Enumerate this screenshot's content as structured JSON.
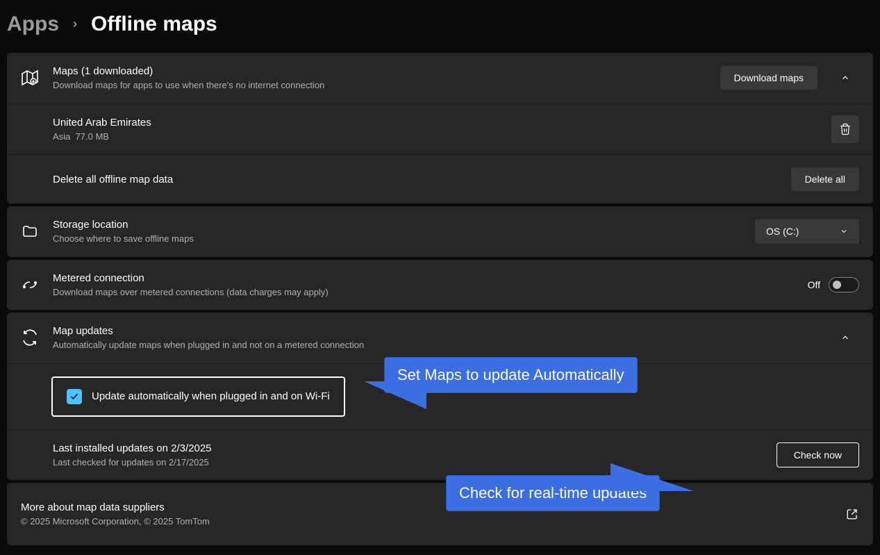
{
  "breadcrumb": {
    "parent": "Apps",
    "current": "Offline maps"
  },
  "maps_section": {
    "title": "Maps (1 downloaded)",
    "subtitle": "Download maps for apps to use when there's no internet connection",
    "download_btn": "Download maps",
    "items": [
      {
        "name": "United Arab Emirates",
        "region": "Asia",
        "size": "77.0 MB"
      }
    ],
    "delete_all_title": "Delete all offline map data",
    "delete_all_btn": "Delete all"
  },
  "storage": {
    "title": "Storage location",
    "subtitle": "Choose where to save offline maps",
    "selected": "OS (C:)"
  },
  "metered": {
    "title": "Metered connection",
    "subtitle": "Download maps over metered connections (data charges may apply)",
    "toggle_state": "Off"
  },
  "updates": {
    "title": "Map updates",
    "subtitle": "Automatically update maps when plugged in and not on a metered connection",
    "checkbox_label": "Update automatically when plugged in and on Wi-Fi",
    "last_installed": "Last installed updates on 2/3/2025",
    "last_checked": "Last checked for updates on 2/17/2025",
    "check_btn": "Check now"
  },
  "about": {
    "title": "More about map data suppliers",
    "copyright": "© 2025 Microsoft Corporation, © 2025 TomTom"
  },
  "callouts": {
    "auto_update": "Set Maps to update Automatically",
    "check_now": "Check for real-time updates"
  }
}
